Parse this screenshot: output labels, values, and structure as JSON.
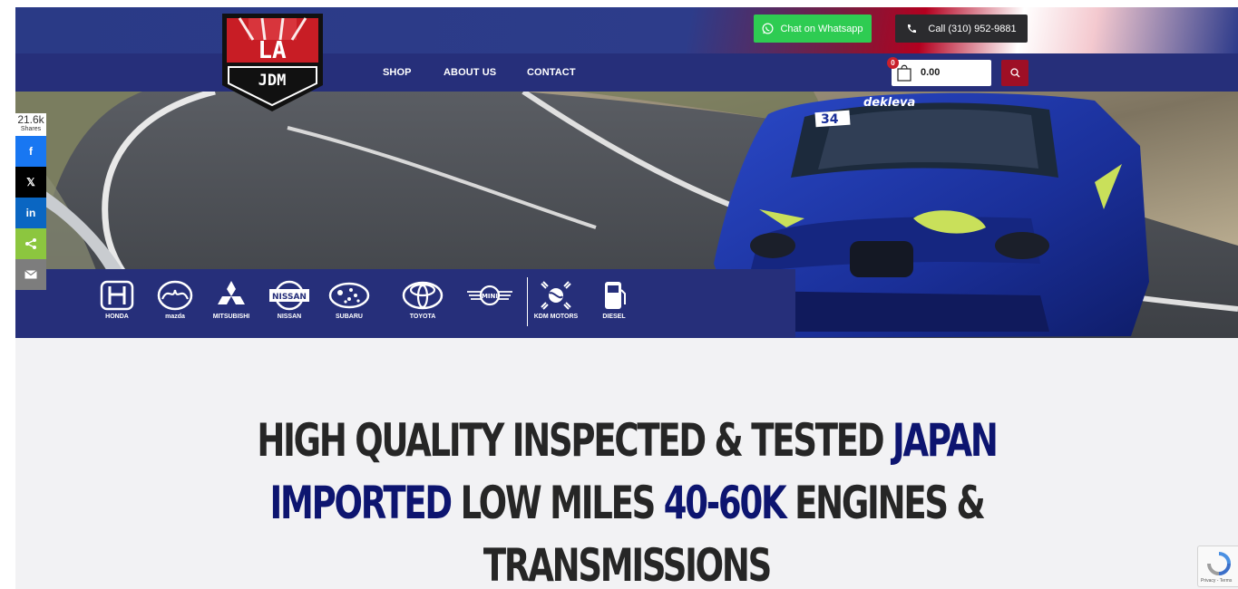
{
  "header": {
    "whatsapp_label": "Chat on Whatsapp",
    "call_label": "Call (310) 952-9881",
    "logo": {
      "text_top": "LA",
      "text_bottom": "JDM"
    },
    "nav": [
      {
        "label": "SHOP"
      },
      {
        "label": "ABOUT US"
      },
      {
        "label": "CONTACT"
      }
    ],
    "cart": {
      "count": "0",
      "amount": "0.00"
    }
  },
  "hero": {
    "car_number": "34",
    "car_banner_text": "dekleva"
  },
  "brands": [
    {
      "name": "HONDA",
      "icon": "honda-logo-icon"
    },
    {
      "name": "mazda",
      "icon": "mazda-logo-icon"
    },
    {
      "name": "MITSUBISHI",
      "icon": "mitsubishi-logo-icon"
    },
    {
      "name": "NISSAN",
      "icon": "nissan-logo-icon",
      "badge": "NISSAN"
    },
    {
      "name": "SUBARU",
      "icon": "subaru-logo-icon"
    },
    {
      "name": "TOYOTA",
      "icon": "toyota-logo-icon"
    },
    {
      "name": "",
      "icon": "mini-logo-icon",
      "badge": "MINI"
    },
    {
      "name": "KDM MOTORS",
      "icon": "kdm-logo-icon"
    },
    {
      "name": "DIESEL",
      "icon": "fuel-pump-icon"
    }
  ],
  "share": {
    "count": "21.6k",
    "count_label": "Shares",
    "buttons": [
      {
        "icon": "facebook-icon",
        "color": "#1877f2",
        "glyph": "f"
      },
      {
        "icon": "x-icon",
        "color": "#000000",
        "glyph": "𝕏"
      },
      {
        "icon": "linkedin-icon",
        "color": "#0a66c2",
        "glyph": "in"
      },
      {
        "icon": "sharethis-icon",
        "color": "#8cc63f",
        "glyph": ""
      },
      {
        "icon": "email-icon",
        "color": "#7d7d7d",
        "glyph": ""
      }
    ]
  },
  "headline": {
    "line1_a": "HIGH QUALITY INSPECTED & TESTED ",
    "line1_b": "JAPAN",
    "line2_a": "IMPORTED",
    "line2_b": " LOW MILES ",
    "line2_c": "40-60K",
    "line2_d": " ENGINES &",
    "line3": "TRANSMISSIONS"
  },
  "recaptcha": {
    "text": "Privacy - Terms"
  },
  "colors": {
    "nav_blue": "#262f7a",
    "whatsapp_green": "#2ecc52",
    "call_dark": "#2b2b2e",
    "search_red": "#9e0f25",
    "headline_highlight": "#0d1570"
  }
}
